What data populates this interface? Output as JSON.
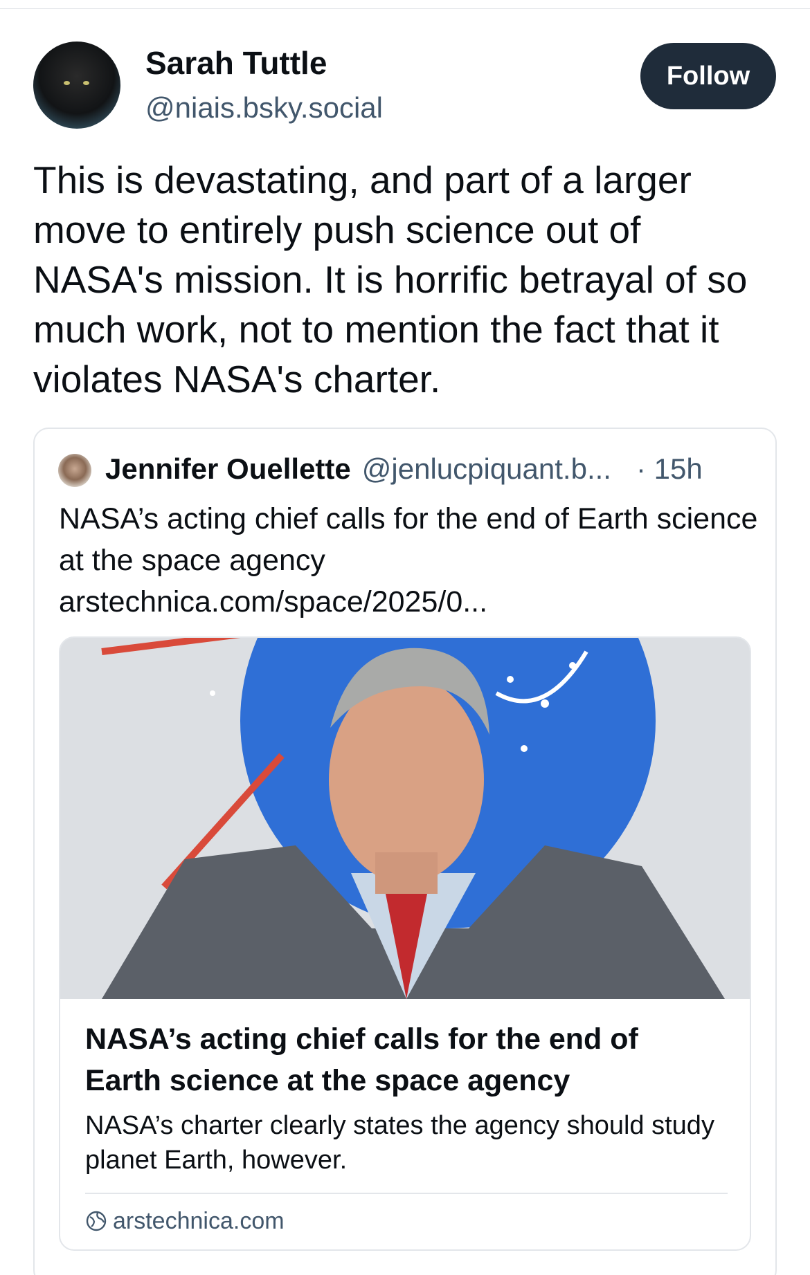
{
  "post": {
    "author_name": "Sarah Tuttle",
    "author_handle": "@niais.bsky.social",
    "follow_label": "Follow",
    "text": "This is devastating, and part of a larger move to entirely push science out of NASA's mission. It is horrific betrayal of so much work, not to mention the fact that it violates NASA's charter."
  },
  "quoted": {
    "author_name": "Jennifer Ouellette",
    "author_handle": "@jenlucpiquant.b...",
    "time": "· 15h",
    "text": "NASA’s acting chief calls for the end of Earth science at the space agency arstechnica.com/space/2025/0...",
    "embed": {
      "title": "NASA’s acting chief calls for the end of Earth science at the space agency",
      "description": "NASA’s charter clearly states the agency should study planet Earth, however.",
      "domain": "arstechnica.com",
      "domain_icon": "globe-icon"
    }
  },
  "colors": {
    "follow_bg": "#1f2c3a",
    "secondary_text": "#42576c",
    "border": "#e3e6ea"
  }
}
